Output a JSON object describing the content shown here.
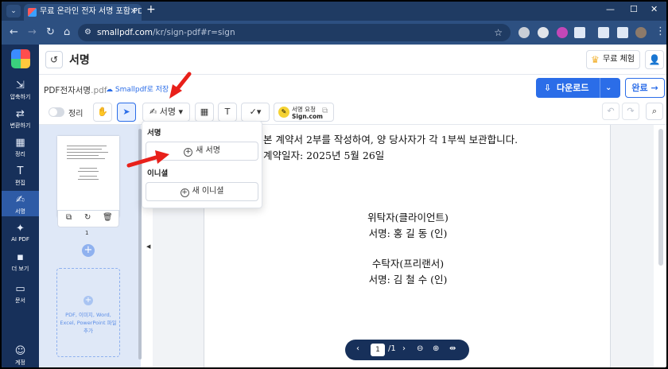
{
  "browser": {
    "tab_title": "무료 온라인 전자 서명 포함 PDF",
    "url_host": "smallpdf.com",
    "url_path": "/kr/sign-pdf#r=sign"
  },
  "sidebar": {
    "items": [
      {
        "label": "압축하기",
        "icon": "compress-icon"
      },
      {
        "label": "변환하기",
        "icon": "convert-icon"
      },
      {
        "label": "정리",
        "icon": "grid-icon"
      },
      {
        "label": "편집",
        "icon": "text-icon"
      },
      {
        "label": "서명",
        "icon": "signature-icon"
      },
      {
        "label": "AI PDF",
        "icon": "sparkle-icon"
      },
      {
        "label": "더 보기",
        "icon": "more-icon"
      },
      {
        "label": "문서",
        "icon": "folder-icon"
      },
      {
        "label": "계정",
        "icon": "account-icon"
      }
    ]
  },
  "header": {
    "title": "서명",
    "trial_label": "무료 체험"
  },
  "file": {
    "name": "PDF전자서명",
    "ext": ".pdf",
    "save_label": "Smallpdf로 저장"
  },
  "actions": {
    "download": "다운로드",
    "done": "완료"
  },
  "toolbar": {
    "organize_label": "정리",
    "sign_label": "서명",
    "sign_request_line1": "서명 요청",
    "sign_request_line2": "Sign.com"
  },
  "thumbnails": {
    "page_number": "1",
    "drop_text": "PDF, 이미지, Word, Excel, PowerPoint 파일 추가"
  },
  "dropdown": {
    "section_signature": "서명",
    "new_signature": "새 서명",
    "section_initials": "이니셜",
    "new_initials": "새 이니셜"
  },
  "document": {
    "line1": "본 계약서 2부를 작성하여, 양 당사자가 각 1부씩 보관합니다.",
    "line2": "계약일자: 2025년 5월 26일",
    "client_title": "위탁자(클라이언트)",
    "client_sign": "서명: 홍 길 동  (인)",
    "freelancer_title": "수탁자(프리랜서)",
    "freelancer_sign": "서명: 김 철 수 (인)"
  },
  "pagenav": {
    "current": "1",
    "total": "/1"
  },
  "colors": {
    "accent": "#2b6de8",
    "sidebar_bg": "#17305a",
    "annotation_arrow": "#e8201a"
  }
}
